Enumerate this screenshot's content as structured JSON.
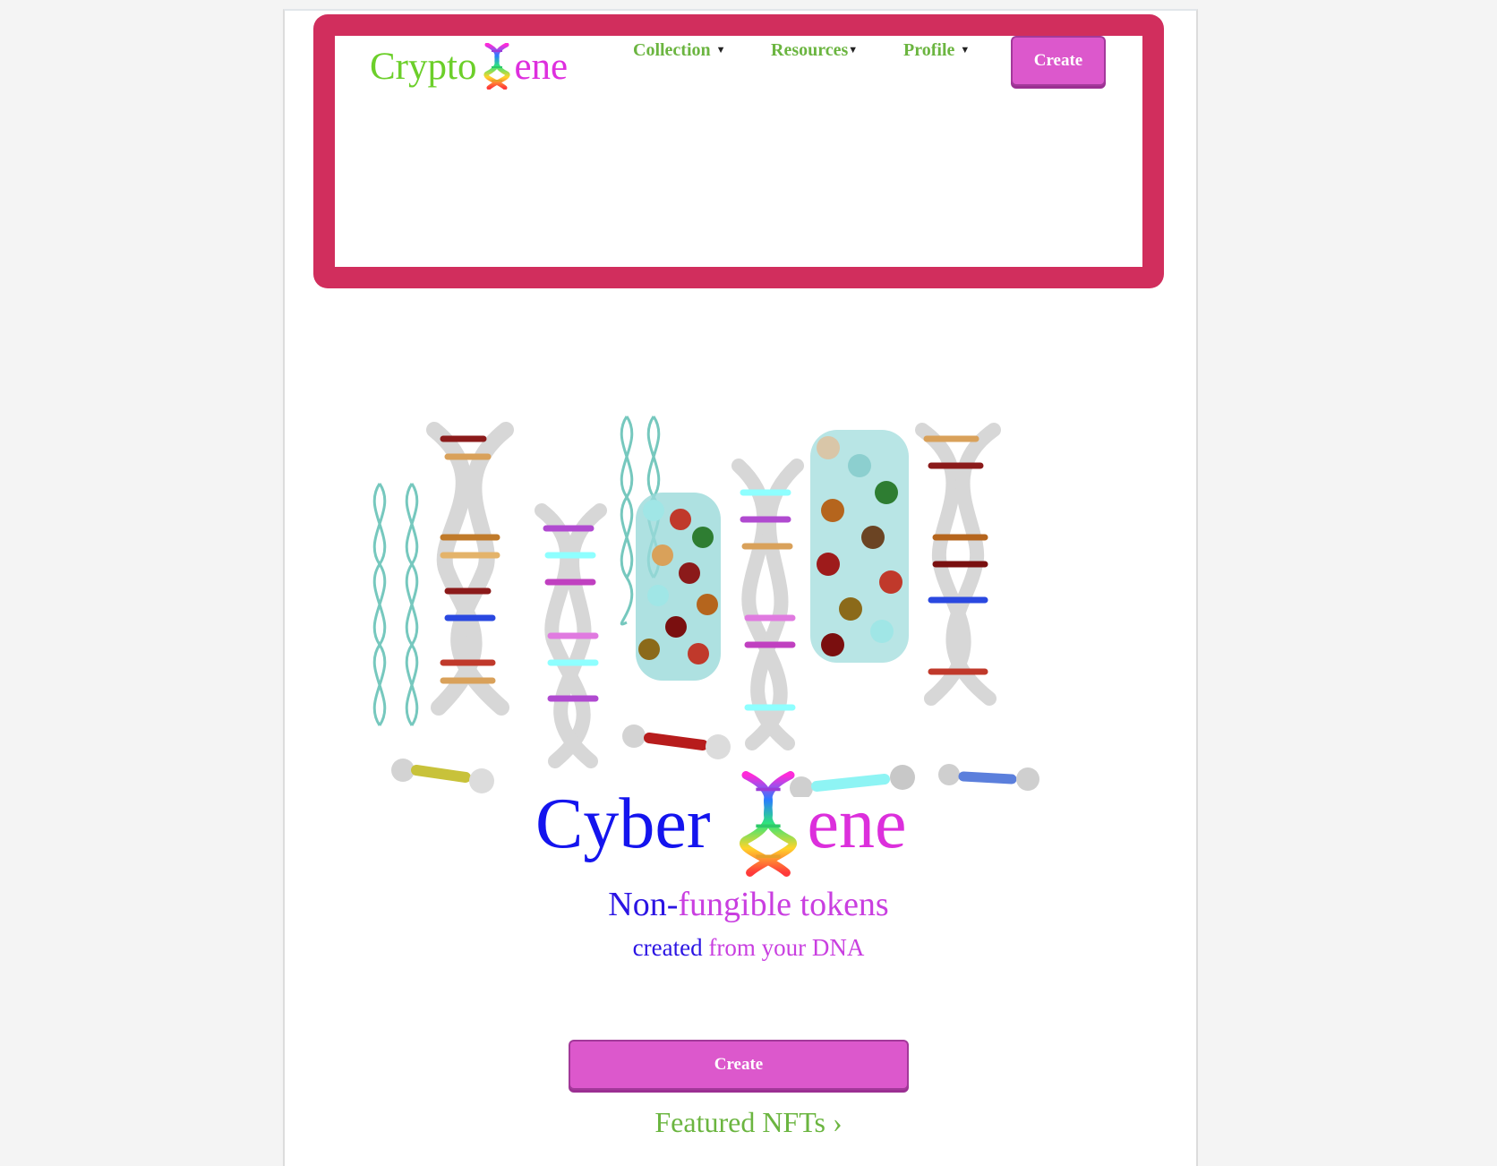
{
  "header": {
    "logo": {
      "part1": "Crypto",
      "part2": "ene"
    },
    "nav": [
      {
        "label": "Collection"
      },
      {
        "label": "Resources"
      },
      {
        "label": "Profile"
      }
    ],
    "create_label": "Create"
  },
  "hero": {
    "title_part1": "Cyber",
    "title_part2": "ene",
    "tagline_line1_a": "Non-",
    "tagline_line1_b": "fungible tokens",
    "tagline_line2_a": "created",
    "tagline_line2_b": " from your DNA",
    "create_label": "Create",
    "featured_label": "Featured NFTs ›"
  },
  "colors": {
    "accent_button": "#dc58cc",
    "nav_text": "#6bb540",
    "highlight_frame": "#d12e5d"
  }
}
